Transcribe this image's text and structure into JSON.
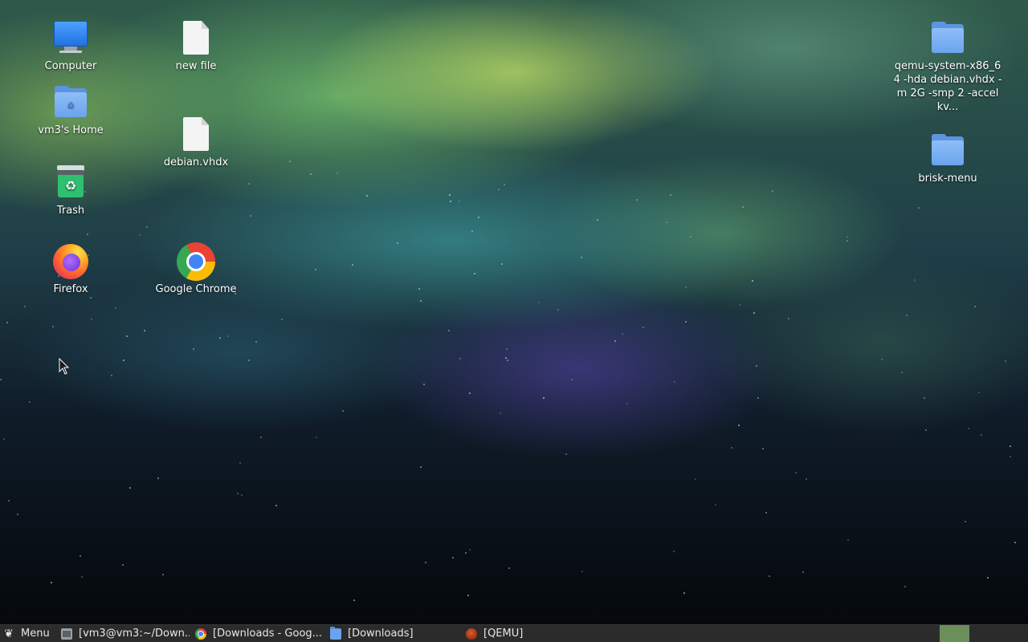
{
  "desktop": {
    "icons": [
      {
        "label": "Computer",
        "icon": "computer-icon"
      },
      {
        "label": "vm3's Home",
        "icon": "home-folder-icon"
      },
      {
        "label": "Trash",
        "icon": "trash-icon"
      },
      {
        "label": "Firefox",
        "icon": "firefox-icon"
      },
      {
        "label": "new file",
        "icon": "file-icon"
      },
      {
        "label": "debian.vhdx",
        "icon": "file-icon"
      },
      {
        "label": "Google Chrome",
        "icon": "chrome-icon"
      },
      {
        "label": "qemu-system-x86_64 -hda debian.vhdx -m 2G -smp 2 -accel kv...",
        "icon": "folder-icon"
      },
      {
        "label": "brisk-menu",
        "icon": "folder-icon"
      }
    ]
  },
  "taskbar": {
    "menu_label": "Menu",
    "windows": [
      {
        "label": "[vm3@vm3:~/Down...",
        "icon": "terminal-icon"
      },
      {
        "label": "[Downloads - Goog...",
        "icon": "chrome-icon"
      },
      {
        "label": "[Downloads]",
        "icon": "folder-icon"
      },
      {
        "label": "[QEMU]",
        "icon": "qemu-icon"
      }
    ]
  },
  "colors": {
    "taskbar_bg": "#2b2b2b",
    "workspace_active": "#6a8f5a"
  }
}
